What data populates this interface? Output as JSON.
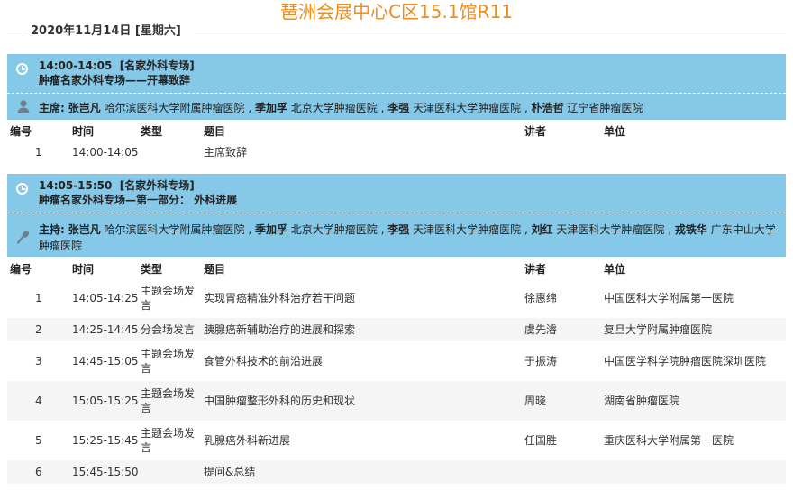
{
  "hall_title": "琶洲会展中心C区15.1馆R11",
  "date": "2020年11月14日 [星期六]",
  "columns": {
    "num": "编号",
    "time": "时间",
    "type": "类型",
    "topic": "题目",
    "speaker": "讲者",
    "unit": "单位"
  },
  "sessions": [
    {
      "time": "14:00-14:05",
      "tag": "[名家外科专场]",
      "subtitle": "肿瘤名家外科专场——开幕致辞",
      "chair_label": "主席:",
      "chairs": [
        {
          "name": "张岂凡",
          "unit": "哈尔滨医科大学附属肿瘤医院"
        },
        {
          "name": "季加孚",
          "unit": "北京大学肿瘤医院"
        },
        {
          "name": "李强",
          "unit": "天津医科大学肿瘤医院"
        },
        {
          "name": "朴浩哲",
          "unit": "辽宁省肿瘤医院"
        }
      ],
      "rows": [
        {
          "num": "1",
          "time": "14:00-14:05",
          "type": "",
          "topic": "主席致辞",
          "speaker": "",
          "unit": ""
        }
      ]
    },
    {
      "time": "14:05-15:50",
      "tag": "[名家外科专场]",
      "subtitle": "肿瘤名家外科专场—第一部分： 外科进展",
      "chair_label": "主持:",
      "chairs": [
        {
          "name": "张岂凡",
          "unit": "哈尔滨医科大学附属肿瘤医院"
        },
        {
          "name": "季加孚",
          "unit": "北京大学肿瘤医院"
        },
        {
          "name": "李强",
          "unit": "天津医科大学肿瘤医院"
        },
        {
          "name": "刘红",
          "unit": "天津医科大学肿瘤医院"
        },
        {
          "name": "戎铁华",
          "unit": "广东中山大学肿瘤医院"
        }
      ],
      "rows": [
        {
          "num": "1",
          "time": "14:05-14:25",
          "type": "主题会场发言",
          "topic": "实现胃癌精准外科治疗若干问题",
          "speaker": "徐惠绵",
          "unit": "中国医科大学附属第一医院"
        },
        {
          "num": "2",
          "time": "14:25-14:45",
          "type": "分会场发言",
          "topic": "胰腺癌新辅助治疗的进展和探索",
          "speaker": "虞先濬",
          "unit": "复旦大学附属肿瘤医院"
        },
        {
          "num": "3",
          "time": "14:45-15:05",
          "type": "主题会场发言",
          "topic": "食管外科技术的前沿进展",
          "speaker": "于振涛",
          "unit": "中国医学科学院肿瘤医院深圳医院"
        },
        {
          "num": "4",
          "time": "15:05-15:25",
          "type": "主题会场发言",
          "topic": "中国肿瘤整形外科的历史和现状",
          "speaker": "周晓",
          "unit": "湖南省肿瘤医院"
        },
        {
          "num": "5",
          "time": "15:25-15:45",
          "type": "主题会场发言",
          "topic": "乳腺癌外科新进展",
          "speaker": "任国胜",
          "unit": "重庆医科大学附属第一医院"
        },
        {
          "num": "6",
          "time": "15:45-15:50",
          "type": "",
          "topic": "提问&总结",
          "speaker": "",
          "unit": ""
        }
      ]
    }
  ],
  "colors": {
    "title_orange": "#f08c1c",
    "session_blue": "#86c8e8",
    "row_alt": "#f5f5f5"
  },
  "icons": {
    "session_header": "clock-icon",
    "chair_s1": "person-icon",
    "chair_s2": "microphone-icon"
  }
}
